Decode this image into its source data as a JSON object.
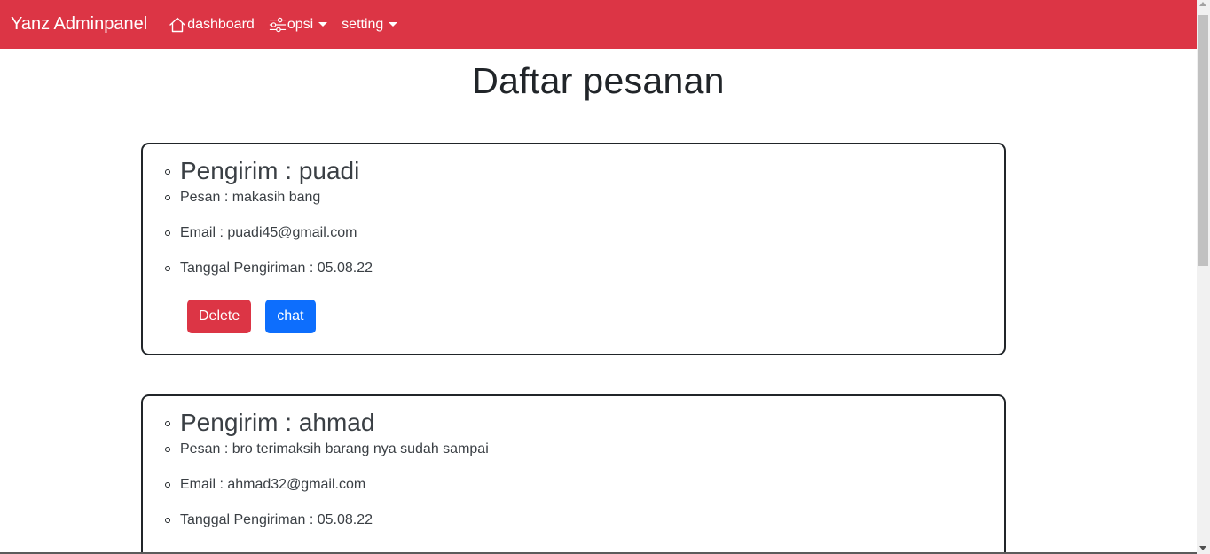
{
  "navbar": {
    "brand": "Yanz Adminpanel",
    "items": [
      {
        "label": "dashboard",
        "icon": "house-icon",
        "dropdown": false
      },
      {
        "label": "opsi",
        "icon": "sliders-icon",
        "dropdown": true
      },
      {
        "label": "setting",
        "icon": "",
        "dropdown": true
      }
    ],
    "color": "#dc3545"
  },
  "page": {
    "title": "Daftar pesanan"
  },
  "messages": [
    {
      "sender": "Pengirim : puadi",
      "message": "Pesan : makasih bang",
      "email": "Email : puadi45@gmail.com",
      "date": "Tanggal Pengiriman : 05.08.22",
      "delete_label": "Delete",
      "chat_label": "chat"
    },
    {
      "sender": "Pengirim : ahmad",
      "message": "Pesan : bro terimaksih barang nya sudah sampai",
      "email": "Email : ahmad32@gmail.com",
      "date": "Tanggal Pengiriman : 05.08.22"
    }
  ],
  "colors": {
    "delete_button": "#dc3545",
    "chat_button": "#0d6efd"
  }
}
